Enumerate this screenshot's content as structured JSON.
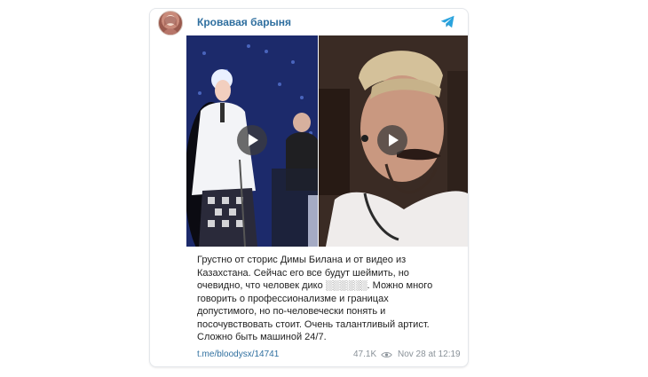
{
  "post": {
    "channel_name": "Кровавая барыня",
    "text": "Грустно от сторис Димы Билана и от видео из\nКазахстана. Сейчас его все будут шеймить, но\nочевидно, что человек дико ░░░░░░. Можно много\nговорить о профессионализме и границах\nдопустимого, но по-человечески понять и\nпосочувствовать стоит. Очень талантливый артист.\nСложно быть машиной 24/7.",
    "link": "t.me/bloodysx/14741",
    "views": "47.1K",
    "timestamp": "Nov 28 at 12:19"
  },
  "icons": {
    "avatar": "channel-avatar",
    "logo": "telegram-icon",
    "play": "play-icon",
    "views": "eye-icon"
  },
  "colors": {
    "link": "#2f6f9f",
    "accent": "#2aa3dd"
  }
}
